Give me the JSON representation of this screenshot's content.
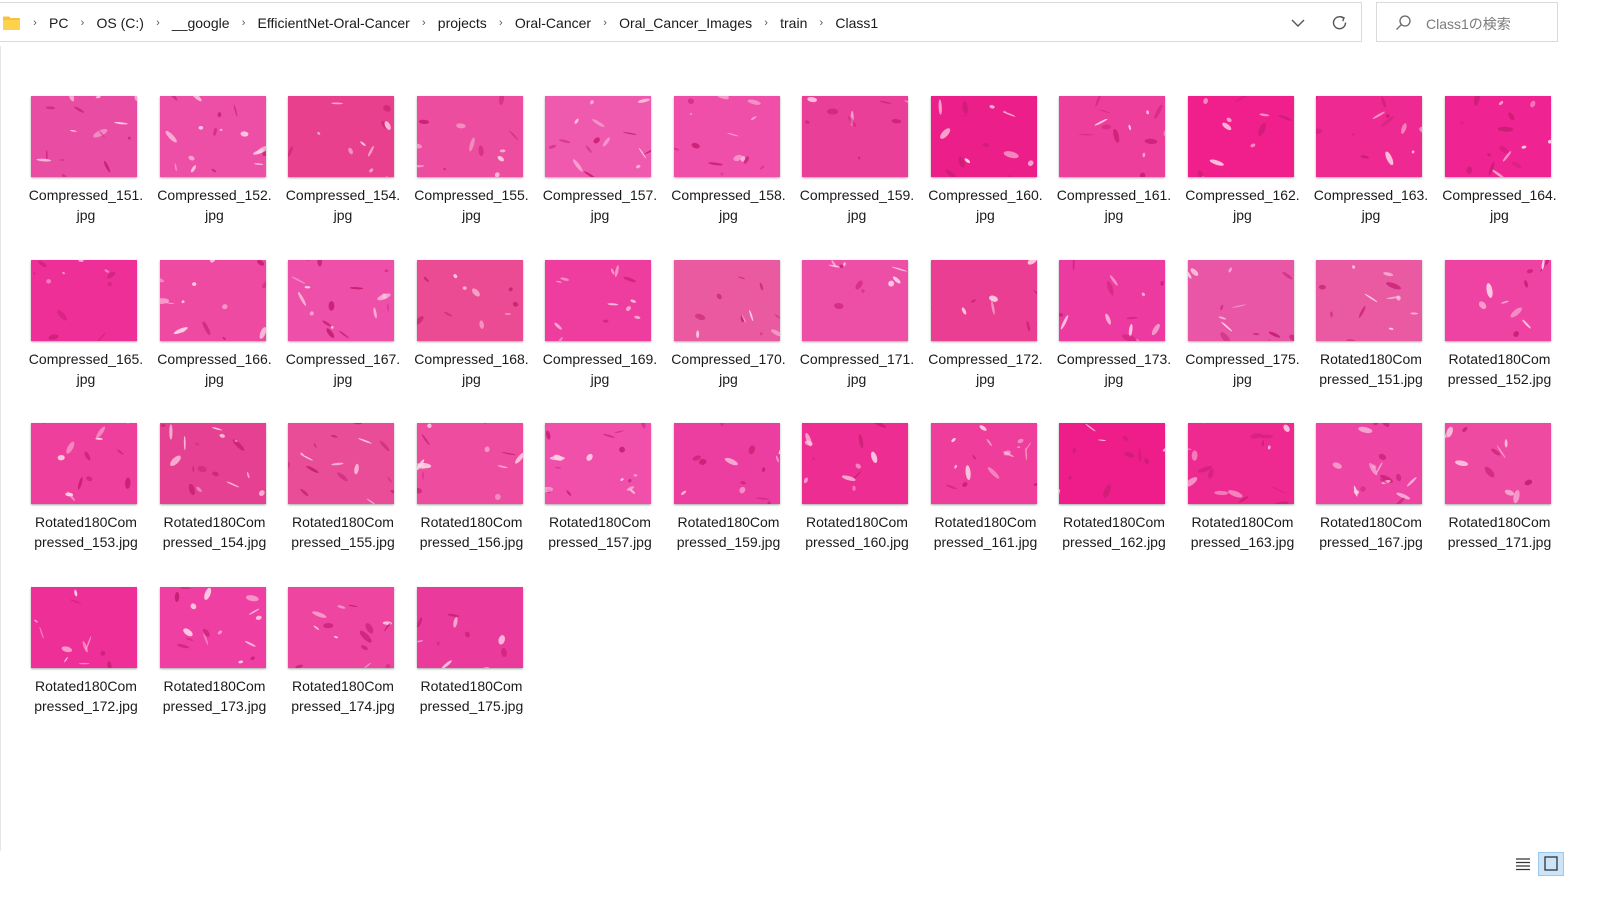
{
  "breadcrumb": [
    "PC",
    "OS (C:)",
    "__google",
    "EfficientNet-Oral-Cancer",
    "projects",
    "Oral-Cancer",
    "Oral_Cancer_Images",
    "train",
    "Class1"
  ],
  "search": {
    "placeholder": "Class1の検索"
  },
  "files": [
    {
      "name": "Compressed_151.\njpg",
      "tone": "#e94da3"
    },
    {
      "name": "Compressed_152.\njpg",
      "tone": "#ee4fa6"
    },
    {
      "name": "Compressed_154.\njpg",
      "tone": "#e8408d"
    },
    {
      "name": "Compressed_155.\njpg",
      "tone": "#ec4d9e"
    },
    {
      "name": "Compressed_157.\njpg",
      "tone": "#f05aae"
    },
    {
      "name": "Compressed_158.\njpg",
      "tone": "#ef4fa8"
    },
    {
      "name": "Compressed_159.\njpg",
      "tone": "#ea3f98"
    },
    {
      "name": "Compressed_160.\njpg",
      "tone": "#ec1f8a"
    },
    {
      "name": "Compressed_161.\njpg",
      "tone": "#ee3e9b"
    },
    {
      "name": "Compressed_162.\njpg",
      "tone": "#f01f8c"
    },
    {
      "name": "Compressed_163.\njpg",
      "tone": "#ee2991"
    },
    {
      "name": "Compressed_164.\njpg",
      "tone": "#f02392"
    },
    {
      "name": "Compressed_165.\njpg",
      "tone": "#ee2f98"
    },
    {
      "name": "Compressed_166.\njpg",
      "tone": "#ee4aa2"
    },
    {
      "name": "Compressed_167.\njpg",
      "tone": "#ee4fa8"
    },
    {
      "name": "Compressed_168.\njpg",
      "tone": "#ea4b93"
    },
    {
      "name": "Compressed_169.\njpg",
      "tone": "#ef3d9f"
    },
    {
      "name": "Compressed_170.\njpg",
      "tone": "#e95aa0"
    },
    {
      "name": "Compressed_171.\njpg",
      "tone": "#ee4fa6"
    },
    {
      "name": "Compressed_172.\njpg",
      "tone": "#ea3e92"
    },
    {
      "name": "Compressed_173.\njpg",
      "tone": "#ec3aa0"
    },
    {
      "name": "Compressed_175.\njpg",
      "tone": "#e956a6"
    },
    {
      "name": "Rotated180Com\npressed_151.jpg",
      "tone": "#e95aa2"
    },
    {
      "name": "Rotated180Com\npressed_152.jpg",
      "tone": "#ee43a2"
    },
    {
      "name": "Rotated180Com\npressed_153.jpg",
      "tone": "#ef3f9c"
    },
    {
      "name": "Rotated180Com\npressed_154.jpg",
      "tone": "#e64092"
    },
    {
      "name": "Rotated180Com\npressed_155.jpg",
      "tone": "#ea4d98"
    },
    {
      "name": "Rotated180Com\npressed_156.jpg",
      "tone": "#ee4c9f"
    },
    {
      "name": "Rotated180Com\npressed_157.jpg",
      "tone": "#f04faa"
    },
    {
      "name": "Rotated180Com\npressed_159.jpg",
      "tone": "#ec3ea1"
    },
    {
      "name": "Rotated180Com\npressed_160.jpg",
      "tone": "#ed2d92"
    },
    {
      "name": "Rotated180Com\npressed_161.jpg",
      "tone": "#ee3d9b"
    },
    {
      "name": "Rotated180Com\npressed_162.jpg",
      "tone": "#ef1d8a"
    },
    {
      "name": "Rotated180Com\npressed_163.jpg",
      "tone": "#ee2a90"
    },
    {
      "name": "Rotated180Com\npressed_167.jpg",
      "tone": "#ee45a4"
    },
    {
      "name": "Rotated180Com\npressed_171.jpg",
      "tone": "#ee4aa2"
    },
    {
      "name": "Rotated180Com\npressed_172.jpg",
      "tone": "#ee2f98"
    },
    {
      "name": "Rotated180Com\npressed_173.jpg",
      "tone": "#ef3fa2"
    },
    {
      "name": "Rotated180Com\npressed_174.jpg",
      "tone": "#ee45a0"
    },
    {
      "name": "Rotated180Com\npressed_175.jpg",
      "tone": "#ea3a9c"
    }
  ]
}
